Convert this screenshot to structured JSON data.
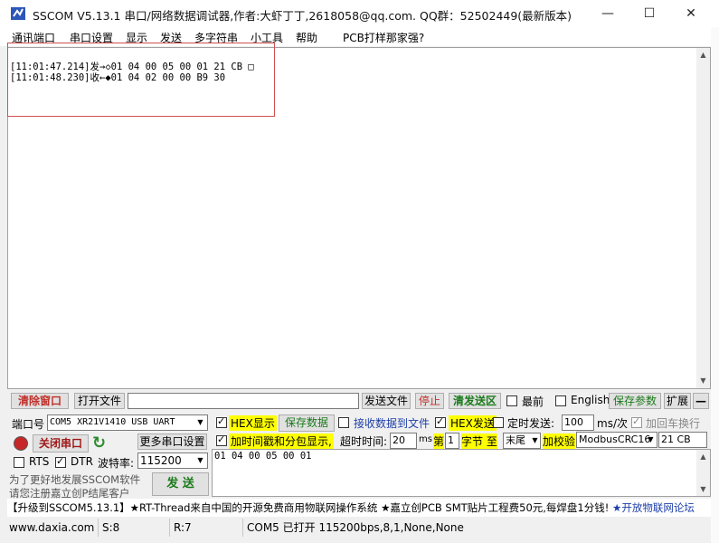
{
  "window": {
    "title": "SSCOM V5.13.1 串口/网络数据调试器,作者:大虾丁丁,2618058@qq.com. QQ群：52502449(最新版本)",
    "minimize_glyph": "—",
    "maximize_glyph": "☐",
    "close_glyph": "✕"
  },
  "menu": [
    "通讯端口",
    "串口设置",
    "显示",
    "发送",
    "多字符串",
    "小工具",
    "帮助",
    "PCB打样那家强?"
  ],
  "receive": {
    "lines": [
      "[11:01:47.214]发→◇01 04 00 05 00 01 21 CB □",
      "[11:01:48.230]收←◆01 04 02 00 00 B9 30"
    ]
  },
  "toolbar1": {
    "clear_window": "清除窗口",
    "open_file": "打开文件",
    "file_path": "",
    "send_file": "发送文件",
    "stop": "停止",
    "clear_send": "清发送区",
    "topmost": "最前",
    "english": "English",
    "save_params": "保存参数",
    "expand": "扩展",
    "collapse": "—"
  },
  "row2": {
    "port_label": "端口号",
    "port_value": "COM5 XR21V1410 USB UART",
    "hex_display": "HEX显示",
    "save_data": "保存数据",
    "recv_to_file": "接收数据到文件",
    "hex_send": "HEX发送",
    "timed_send": "定时发送:",
    "interval": "100",
    "interval_unit": "ms/次",
    "add_crlf": "加回车换行"
  },
  "row3": {
    "close_port": "关闭串口",
    "more_settings": "更多串口设置",
    "timestamp_split": "加时间戳和分包显示,",
    "timeout_label": "超时时间:",
    "timeout_value": "20",
    "timeout_unit": "ms",
    "byte_prefix": "第",
    "byte_index": "1",
    "byte_to": "字节 至",
    "byte_end": "末尾",
    "checksum_label": "加校验",
    "checksum_type": "ModbusCRC16",
    "checksum_value": "21 CB"
  },
  "row4": {
    "rts": "RTS",
    "dtr": "DTR",
    "baud_label": "波特率:",
    "baud_value": "115200"
  },
  "side_note": {
    "line1": "为了更好地发展SSCOM软件",
    "line2": "请您注册嘉立创P结尾客户"
  },
  "send_button": "发  送",
  "send_text": "01 04 00 05 00 01",
  "ticker": {
    "part1": "【升级到SSCOM5.13.1】★RT-Thread来自中国的开源免费商用物联网操作系统 ★嘉立创PCB SMT贴片工程费50元,每焊盘1分钱! ",
    "part2": "★开放物联网论坛"
  },
  "status": {
    "website": "www.daxia.com",
    "sent": "S:8",
    "received": "R:7",
    "port_info": "COM5 已打开  115200bps,8,1,None,None"
  }
}
